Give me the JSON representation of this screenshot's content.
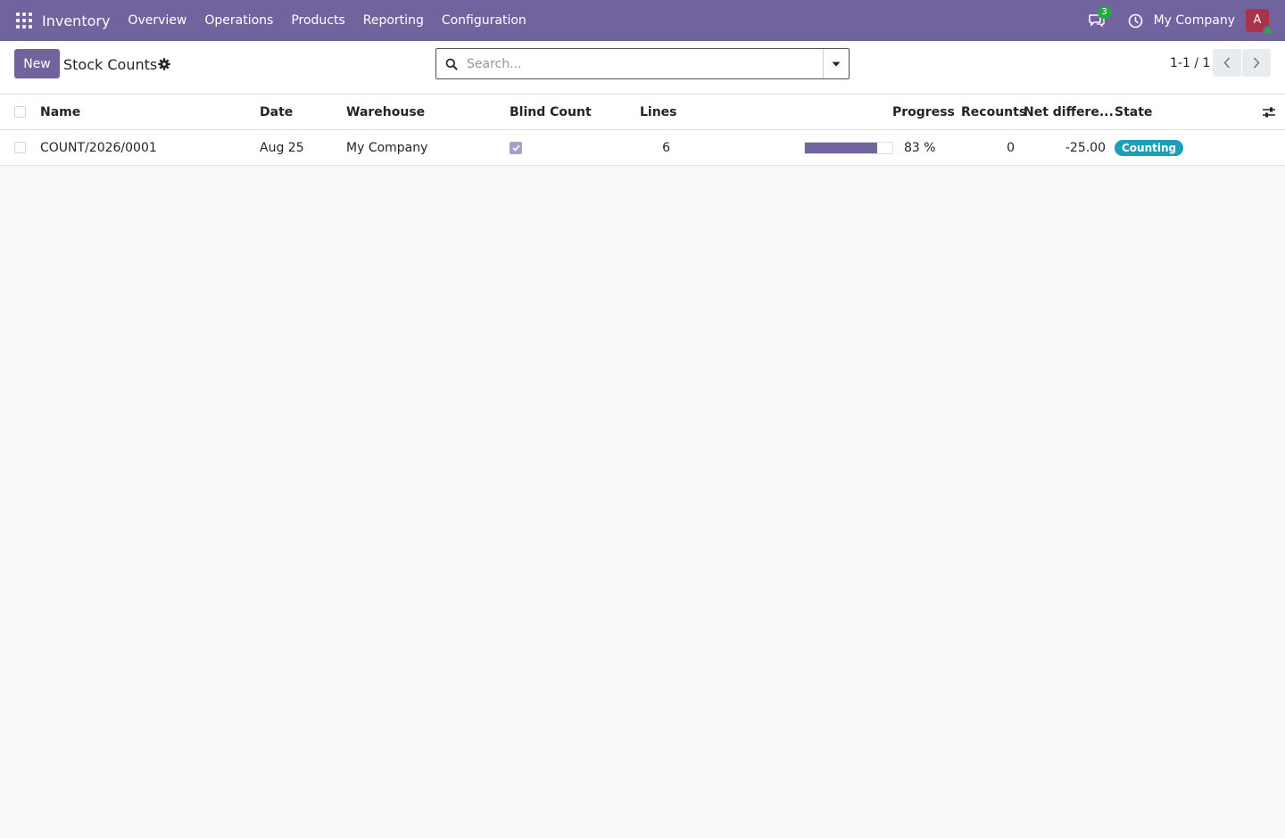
{
  "navbar": {
    "brand": "Inventory",
    "menu": [
      "Overview",
      "Operations",
      "Products",
      "Reporting",
      "Configuration"
    ],
    "chat_count": "3",
    "company": "My Company",
    "avatar_initial": "A"
  },
  "control_panel": {
    "new_label": "New",
    "title": "Stock Counts",
    "search_placeholder": "Search...",
    "pager": "1-1 / 1"
  },
  "table": {
    "headers": {
      "name": "Name",
      "date": "Date",
      "warehouse": "Warehouse",
      "blind_count": "Blind Count",
      "lines": "Lines",
      "progress": "Progress",
      "recounts": "Recounts",
      "net_difference": "Net differe...",
      "state": "State"
    },
    "rows": [
      {
        "name": "COUNT/2026/0001",
        "date": "Aug 25",
        "warehouse": "My Company",
        "blind_count": true,
        "lines": "6",
        "progress_value": 0.83,
        "progress_text": "83 %",
        "recounts": "0",
        "net_difference": "-25.00",
        "state": "Counting"
      }
    ]
  },
  "colors": {
    "brand": "#71639e",
    "state_counting": "#1a9fb6"
  }
}
